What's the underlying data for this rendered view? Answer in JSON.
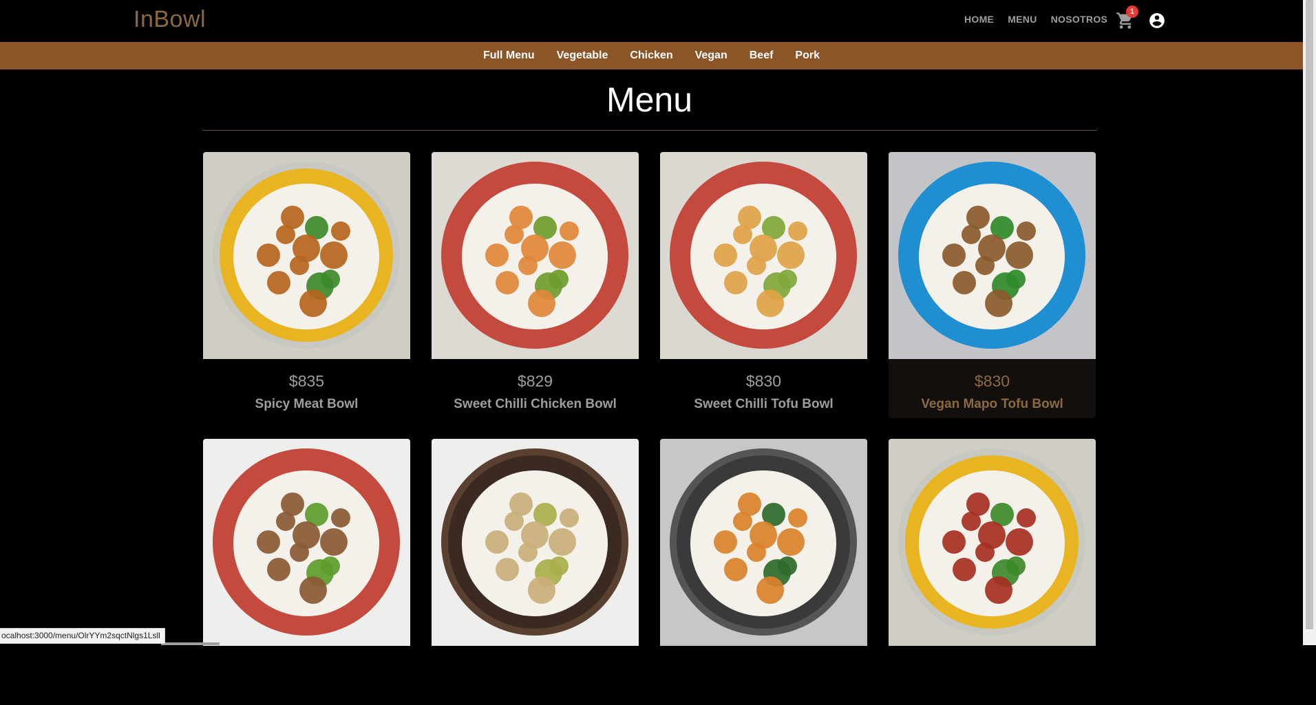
{
  "header": {
    "logo": "InBowl",
    "nav": [
      "HOME",
      "MENU",
      "NOSOTROS"
    ],
    "cart_count": "1"
  },
  "categories": [
    "Full Menu",
    "Vegetable",
    "Chicken",
    "Vegan",
    "Beef",
    "Pork"
  ],
  "page_title": "Menu",
  "items": [
    {
      "price": "$835",
      "name": "Spicy Meat Bowl",
      "bowl": "#e8b422",
      "rim": "#c8c8c2",
      "mat": "#cfcdc4",
      "food": "#b5651d",
      "green": "#3c8a2a"
    },
    {
      "price": "$829",
      "name": "Sweet Chilli Chicken Bowl",
      "bowl": "#c44a3e",
      "rim": "#c44a3e",
      "mat": "#dcdad2",
      "food": "#e0883a",
      "green": "#6e9c2c"
    },
    {
      "price": "$830",
      "name": "Sweet Chilli Tofu Bowl",
      "bowl": "#c44a3e",
      "rim": "#c44a3e",
      "mat": "#dad8d0",
      "food": "#e0a346",
      "green": "#7fa83a"
    },
    {
      "price": "$830",
      "name": "Vegan Mapo Tofu Bowl",
      "bowl": "#1f8fd1",
      "rim": "#1f8fd1",
      "mat": "#c2c4c8",
      "food": "#8a5a2b",
      "green": "#2f8a2a"
    },
    {
      "price": "",
      "name": "",
      "bowl": "#c44a3e",
      "rim": "#c44a3e",
      "mat": "#eeeeec",
      "food": "#8a5a34",
      "green": "#5c9c2c"
    },
    {
      "price": "",
      "name": "",
      "bowl": "#3a2a22",
      "rim": "#5a4030",
      "mat": "#eeeeec",
      "food": "#c9b07a",
      "green": "#a8b04a"
    },
    {
      "price": "",
      "name": "",
      "bowl": "#3a3a3a",
      "rim": "#555555",
      "mat": "#c5c7c8",
      "food": "#d9822b",
      "green": "#2e6a2a"
    },
    {
      "price": "",
      "name": "",
      "bowl": "#e8b422",
      "rim": "#c8c8c2",
      "mat": "#cfcdc4",
      "food": "#a52f22",
      "green": "#3c8a2a"
    }
  ],
  "hovered_index": 3,
  "status_url": "ocalhost:3000/menu/OlrYYm2sqctNlgs1Lsll"
}
